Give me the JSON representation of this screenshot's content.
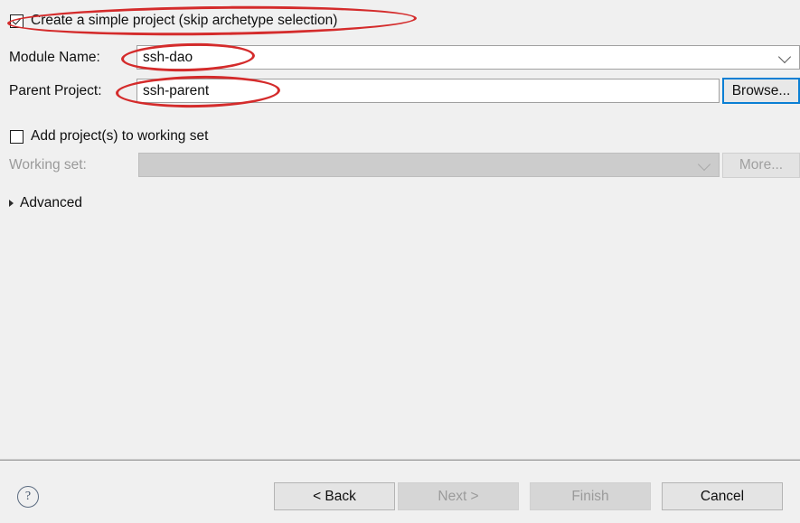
{
  "dialog": {
    "background_color": "#f0f0f0",
    "focus_color": "#0a7fd4",
    "annotation_color": "#d42b2b"
  },
  "form": {
    "simple_project": {
      "label": "Create a simple project (skip archetype selection)",
      "checked": true
    },
    "module_name": {
      "label": "Module Name:",
      "value": "ssh-dao",
      "chevron_icon": "chevron-down-icon"
    },
    "parent_project": {
      "label": "Parent Project:",
      "value": "ssh-parent",
      "browse_label": "Browse..."
    },
    "add_to_working_set": {
      "label": "Add project(s) to working set",
      "checked": false
    },
    "working_set": {
      "label": "Working set:",
      "value": "",
      "more_label": "More...",
      "disabled": true,
      "chevron_icon": "chevron-down-icon"
    },
    "advanced": {
      "label": "Advanced",
      "expander_icon": "triangle-right-icon",
      "expanded": false
    }
  },
  "footer": {
    "help_icon": "help-question-icon",
    "help_glyph": "?",
    "buttons": [
      {
        "label": "< Back",
        "enabled": true
      },
      {
        "label": "Next >",
        "enabled": false
      },
      {
        "label": "Finish",
        "enabled": false
      },
      {
        "label": "Cancel",
        "enabled": true
      }
    ]
  },
  "annotations": [
    {
      "target": "simple-project-checkbox-row",
      "shape": "ellipse"
    },
    {
      "target": "module-name-value",
      "shape": "ellipse"
    },
    {
      "target": "parent-project-value",
      "shape": "ellipse"
    }
  ]
}
